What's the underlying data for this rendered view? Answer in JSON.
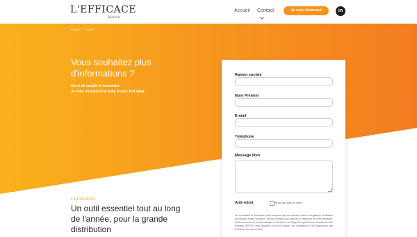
{
  "header": {
    "logo_text": "L'EFFICACE",
    "logo_sub": "Nielsen",
    "nav": {
      "home": "Accueil",
      "contact": "Contact"
    },
    "cta": "Je suis intéressé",
    "linkedin": "in"
  },
  "breadcrumb": [
    "Nielsen",
    "›",
    "Contact"
  ],
  "hero": {
    "title": "Vous souhaitez plus d'informations ?",
    "text_line1": "Merci de remplir le formulaire.",
    "text_line2": "Je vous recontacterai dans le plus bref délai."
  },
  "form": {
    "required_mark": "*",
    "fields": [
      {
        "label": "Raison sociale"
      },
      {
        "label": "Nom Prénom"
      },
      {
        "label": "E-mail"
      },
      {
        "label": "Téléphone"
      },
      {
        "label": "Message libre"
      }
    ],
    "antirobot_label": "Anti-robot",
    "antirobot_text": "Je ne suis pas un robot",
    "legal": "En soumettant ce formulaire, vous acceptez que vos données soient enregistrées et utilisées par Nielsen Panel Formation, Étienne Delaleu pour assurer le traitement de votre demande. Conformément à la loi informatique et Libertés et au Règlement général sur la protection des données (RGPD), vous disposez d'un droit d'accès, de rectification et de suppression des données vous concernant."
  },
  "section": {
    "brand": "L'EFFICACE",
    "title": "Un outil essentiel tout au long de l'année, pour la grande distribution"
  },
  "colors": {
    "orange_light": "#f9b21c",
    "orange_dark": "#f47c20",
    "accent": "#f7941d"
  }
}
